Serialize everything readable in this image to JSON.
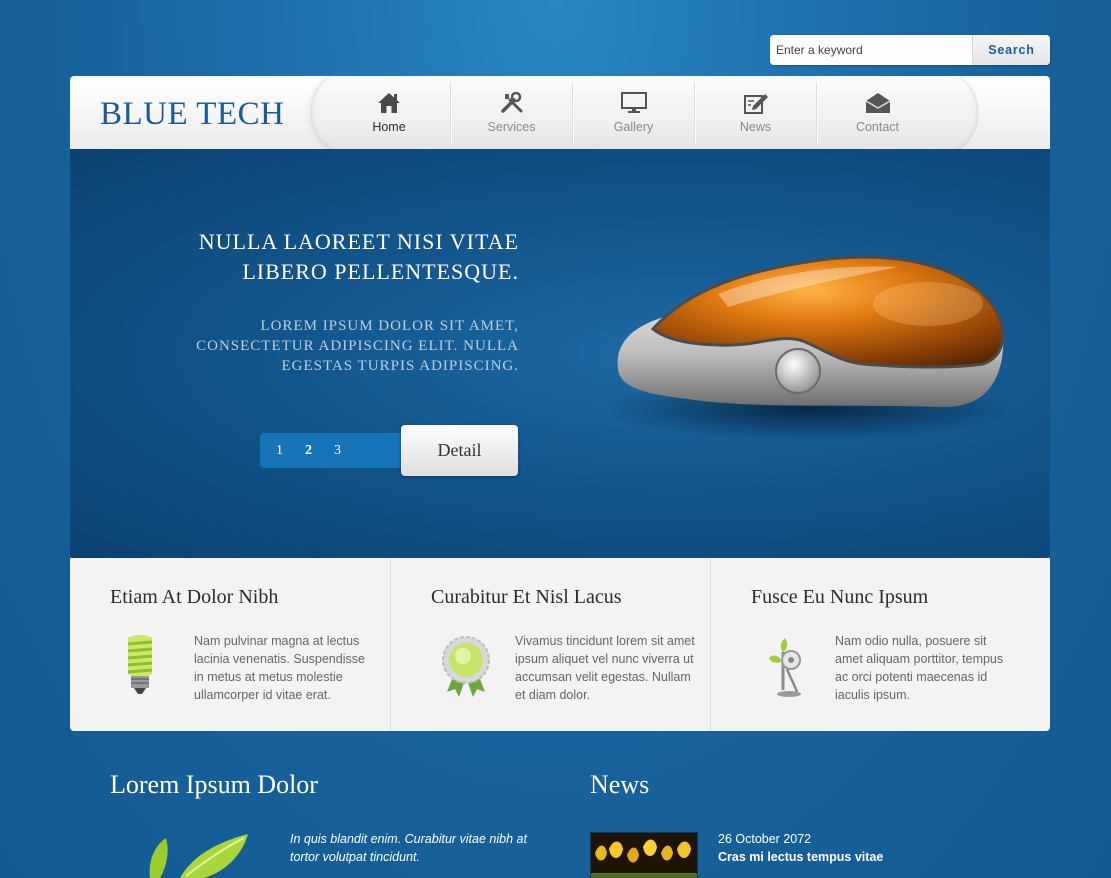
{
  "search": {
    "placeholder": "Enter a keyword",
    "button_label": "Search"
  },
  "brand": {
    "logo_text": "BLUE TECH"
  },
  "nav": {
    "items": [
      {
        "label": "Home",
        "icon": "home-icon",
        "active": true
      },
      {
        "label": "Services",
        "icon": "tools-icon",
        "active": false
      },
      {
        "label": "Gallery",
        "icon": "monitor-icon",
        "active": false
      },
      {
        "label": "News",
        "icon": "edit-icon",
        "active": false
      },
      {
        "label": "Contact",
        "icon": "mail-icon",
        "active": false
      }
    ]
  },
  "hero": {
    "title_line1": "NULLA LAOREET NISI VITAE",
    "title_line2": "LIBERO PELLENTESQUE.",
    "subtitle_line1": "LOREM IPSUM DOLOR SIT AMET,",
    "subtitle_line2": "CONSECTETUR ADIPISCING ELIT. NULLA",
    "subtitle_line3": "EGESTAS TURPIS ADIPISCING.",
    "pages": [
      "1",
      "2",
      "3"
    ],
    "detail_label": "Detail"
  },
  "features": [
    {
      "title": "Etiam At Dolor Nibh",
      "icon": "lightbulb-icon",
      "text": "Nam pulvinar magna at lectus lacinia venenatis. Suspendisse in metus at metus molestie ullamcorper id vitae erat."
    },
    {
      "title": "Curabitur Et Nisl Lacus",
      "icon": "award-badge-icon",
      "text": "Vivamus tincidunt lorem sit amet ipsum aliquet vel nunc viverra ut accumsan velit egestas. Nullam et diam dolor."
    },
    {
      "title": "Fusce Eu Nunc Ipsum",
      "icon": "eco-fan-icon",
      "text": "Nam odio nulla, posuere sit amet aliquam porttitor, tempus ac orci potenti maecenas id iaculis ipsum."
    }
  ],
  "lorem_section": {
    "title": "Lorem Ipsum Dolor",
    "text": "In quis blandit enim. Curabitur vitae nibh at tortor volutpat tincidunt."
  },
  "news_section": {
    "title": "News",
    "date": "26 October 2072",
    "headline": "Cras mi lectus tempus vitae"
  },
  "colors": {
    "background": "#1f73b0",
    "hero": "#13568c",
    "brand": "#1b5b95",
    "pager": "#1674b8"
  }
}
